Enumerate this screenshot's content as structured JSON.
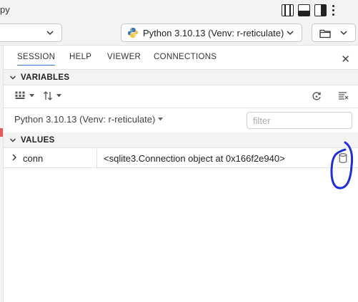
{
  "window": {
    "title_fragment": "py"
  },
  "toolbar": {
    "left_dropdown_value": "",
    "interpreter_label": "Python 3.10.13 (Venv: r-reticulate)"
  },
  "tabs": [
    {
      "label": "SESSION",
      "active": true
    },
    {
      "label": "HELP",
      "active": false
    },
    {
      "label": "VIEWER",
      "active": false
    },
    {
      "label": "CONNECTIONS",
      "active": false
    }
  ],
  "close_label": "✕",
  "variables": {
    "header": "VARIABLES",
    "env_label": "Python 3.10.13 (Venv: r-reticulate)",
    "filter_placeholder": "filter"
  },
  "values": {
    "header": "VALUES",
    "rows": [
      {
        "name": "conn",
        "value": "<sqlite3.Connection object at 0x166f2e940>"
      }
    ]
  },
  "colors": {
    "accent": "#3a7bd5",
    "annotation": "#1f2fd6",
    "marker": "#e45a5a"
  },
  "icons": {
    "layout": [
      "layout-sidebar-icon",
      "layout-panel-icon",
      "layout-sidebar-right-icon",
      "more-icon"
    ],
    "row_action": "database-icon"
  }
}
